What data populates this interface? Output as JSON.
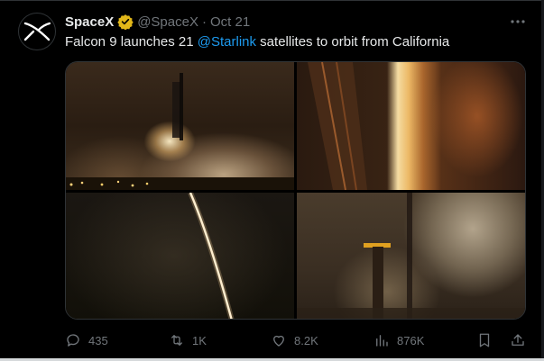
{
  "tweet": {
    "author_name": "SpaceX",
    "handle": "@SpaceX",
    "separator": "·",
    "date": "Oct 21",
    "text_before": "Falcon 9 launches 21 ",
    "mention": "@Starlink",
    "text_after": " satellites to orbit from California",
    "avatar_icon": "spacex-x-logo-icon",
    "verified_icon": "verified-badge-icon",
    "verified_color": "#e2b719",
    "mention_color": "#1d9bf0"
  },
  "media": {
    "photos": [
      {
        "name": "launch-photo-pad-wide"
      },
      {
        "name": "launch-photo-engine-closeup"
      },
      {
        "name": "launch-photo-night-streak"
      },
      {
        "name": "launch-photo-liftoff-smoke"
      }
    ]
  },
  "actions": {
    "replies": "435",
    "reposts": "1K",
    "likes": "8.2K",
    "views": "876K"
  },
  "icons": {
    "more": "more-options-icon",
    "reply": "reply-icon",
    "repost": "repost-icon",
    "like": "like-icon",
    "views": "views-icon",
    "bookmark": "bookmark-icon",
    "share": "share-icon"
  }
}
